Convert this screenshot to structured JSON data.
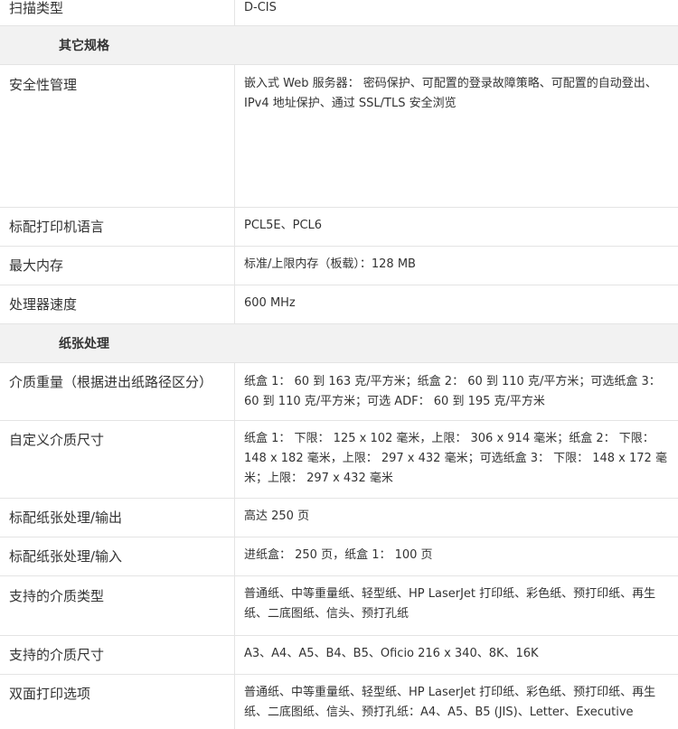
{
  "top_row": {
    "label": "扫描类型",
    "value": "D-CIS"
  },
  "sections": [
    {
      "title": "其它规格",
      "rows": [
        {
          "label": "安全性管理",
          "value": "嵌入式 Web 服务器： 密码保护、可配置的登录故障策略、可配置的自动登出、IPv4 地址保护、通过 SSL/TLS 安全浏览"
        },
        {
          "label": "标配打印机语言",
          "value": "PCL5E、PCL6"
        },
        {
          "label": "最大内存",
          "value": "标准/上限内存（板载）：128 MB"
        },
        {
          "label": "处理器速度",
          "value": "600 MHz"
        }
      ]
    },
    {
      "title": "纸张处理",
      "rows": [
        {
          "label": "介质重量（根据进出纸路径区分）",
          "value": "纸盒 1： 60 到 163 克/平方米；纸盒 2： 60 到 110 克/平方米；可选纸盒 3： 60 到 110 克/平方米；可选 ADF： 60 到 195 克/平方米"
        },
        {
          "label": "自定义介质尺寸",
          "value": "纸盒 1： 下限： 125 x 102 毫米，上限： 306 x 914 毫米；纸盒 2： 下限： 148 x 182 毫米，上限： 297 x 432 毫米；可选纸盒 3： 下限： 148 x 172 毫米；上限： 297 x 432 毫米"
        },
        {
          "label": "标配纸张处理/输出",
          "value": "高达 250 页"
        },
        {
          "label": "标配纸张处理/输入",
          "value": "进纸盒： 250 页，纸盒 1： 100 页"
        },
        {
          "label": "支持的介质类型",
          "value": "普通纸、中等重量纸、轻型纸、HP LaserJet 打印纸、彩色纸、预打印纸、再生纸、二底图纸、信头、预打孔纸"
        },
        {
          "label": "支持的介质尺寸",
          "value": "A3、A4、A5、B4、B5、Oficio 216 x 340、8K、16K"
        },
        {
          "label": "双面打印选项",
          "value": "普通纸、中等重量纸、轻型纸、HP LaserJet 打印纸、彩色纸、预打印纸、再生纸、二底图纸、信头、预打孔纸：A4、A5、B5 (JIS)、Letter、Executive"
        }
      ]
    }
  ]
}
